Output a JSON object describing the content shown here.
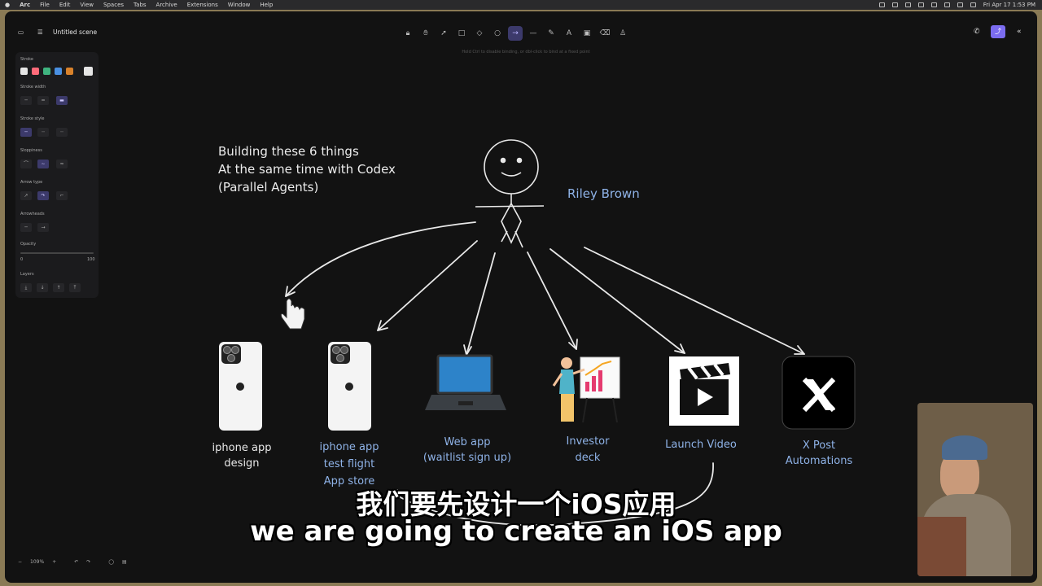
{
  "menubar": {
    "items": [
      "Arc",
      "File",
      "Edit",
      "View",
      "Spaces",
      "Tabs",
      "Archive",
      "Extensions",
      "Window",
      "Help"
    ],
    "clock": "Fri Apr 17  1:53 PM"
  },
  "app": {
    "scene_title": "Untitled scene",
    "hint": "Hold Ctrl to disable binding, or dbl-click to bind at a fixed point"
  },
  "toolbar": {
    "tools": [
      "lock-icon",
      "hand-icon",
      "pointer-icon",
      "rectangle-icon",
      "diamond-icon",
      "ellipse-icon",
      "arrow-icon",
      "line-icon",
      "pencil-icon",
      "text-icon",
      "image-icon",
      "eraser-icon",
      "extra-icon"
    ],
    "active_tool": "arrow-icon"
  },
  "panel": {
    "stroke_label": "Stroke",
    "stroke_colors": [
      "#e5e5e5",
      "#ff6b7a",
      "#3fb37f",
      "#4a90e2",
      "#d9822b"
    ],
    "stroke_width_label": "Stroke width",
    "stroke_style_label": "Stroke style",
    "sloppiness_label": "Sloppiness",
    "arrow_type_label": "Arrow type",
    "arrowheads_label": "Arrowheads",
    "opacity_label": "Opacity",
    "opacity_min": "0",
    "opacity_max": "100",
    "layers_label": "Layers"
  },
  "canvas": {
    "title_lines": [
      "Building these 6 things",
      "At the same time with Codex",
      "(Parallel Agents)"
    ],
    "person_name": "Riley Brown",
    "items": [
      {
        "lines": [
          "iphone app",
          "design"
        ],
        "color": "#e8e8e8",
        "icon": "iphone-icon"
      },
      {
        "lines": [
          "iphone app",
          "test flight",
          "App store"
        ],
        "color": "#8fb3e8",
        "icon": "iphone-icon"
      },
      {
        "lines": [
          "Web app",
          "(waitlist sign up)"
        ],
        "color": "#8fb3e8",
        "icon": "laptop-icon"
      },
      {
        "lines": [
          "Investor",
          "deck"
        ],
        "color": "#8fb3e8",
        "icon": "presenter-icon"
      },
      {
        "lines": [
          "Launch Video"
        ],
        "color": "#8fb3e8",
        "icon": "clapperboard-icon"
      },
      {
        "lines": [
          "X Post",
          "Automations"
        ],
        "color": "#8fb3e8",
        "icon": "x-logo-icon"
      }
    ]
  },
  "subtitles": {
    "zh": "我们要先设计一个iOS应用",
    "en": "we are going to create an iOS app"
  },
  "zoom": "109%"
}
